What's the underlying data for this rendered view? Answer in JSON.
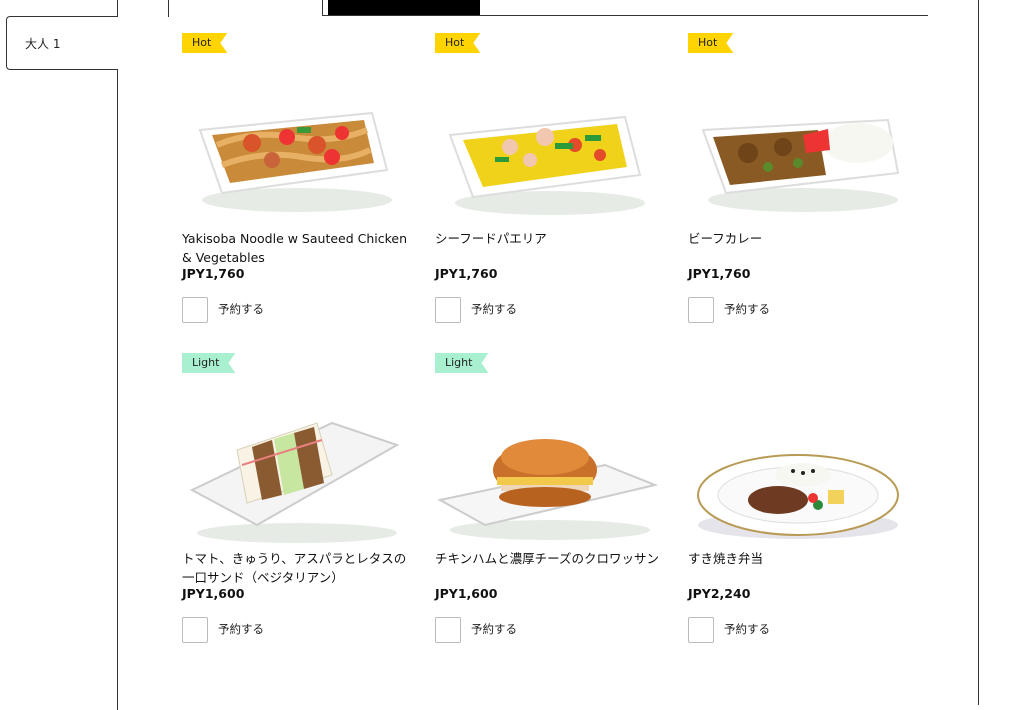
{
  "passenger": {
    "label": "大人 1"
  },
  "meals": [
    {
      "tag": "Hot",
      "tag_color": "#ffd400",
      "name": "Yakisoba Noodle w Sauteed Chicken & Vegetables",
      "price": "JPY1,760",
      "reserve_label": "予約する",
      "image": "yakisoba-noodle-dish"
    },
    {
      "tag": "Hot",
      "tag_color": "#ffd400",
      "name": "シーフードパエリア",
      "price": "JPY1,760",
      "reserve_label": "予約する",
      "image": "seafood-paella-dish"
    },
    {
      "tag": "Hot",
      "tag_color": "#ffd400",
      "name": "ビーフカレー",
      "price": "JPY1,760",
      "reserve_label": "予約する",
      "image": "beef-curry-dish"
    },
    {
      "tag": "Light",
      "tag_color": "#a8f0d0",
      "name": "トマト、きゅうり、アスパラとレタスの一口サンド（ベジタリアン）",
      "price": "JPY1,600",
      "reserve_label": "予約する",
      "image": "vegetable-sandwich-plate"
    },
    {
      "tag": "Light",
      "tag_color": "#a8f0d0",
      "name": "チキンハムと濃厚チーズのクロワッサン",
      "price": "JPY1,600",
      "reserve_label": "予約する",
      "image": "croissant-sandwich-plate"
    },
    {
      "tag": "",
      "tag_color": "",
      "name": "すき焼き弁当",
      "price": "JPY2,240",
      "reserve_label": "予約する",
      "image": "sukiyaki-bento-plate"
    }
  ]
}
